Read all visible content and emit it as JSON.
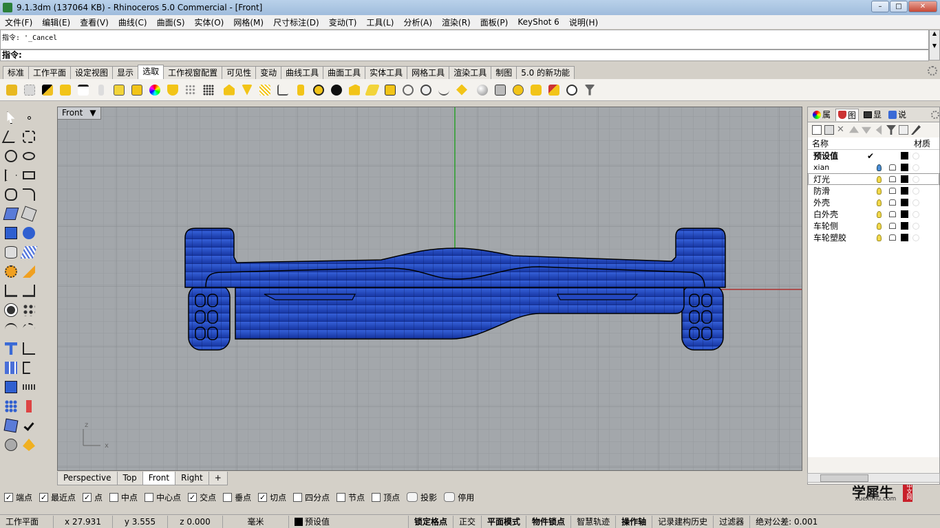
{
  "window": {
    "title": "9.1.3dm (137064 KB) - Rhinoceros 5.0 Commercial - [Front]",
    "minimize": "–",
    "maximize": "□",
    "close": "✕"
  },
  "menu": [
    "文件(F)",
    "编辑(E)",
    "查看(V)",
    "曲线(C)",
    "曲面(S)",
    "实体(O)",
    "网格(M)",
    "尺寸标注(D)",
    "变动(T)",
    "工具(L)",
    "分析(A)",
    "渲染(R)",
    "面板(P)",
    "KeyShot 6",
    "说明(H)"
  ],
  "command": {
    "history": "指令: '_Cancel",
    "prompt": "指令:"
  },
  "toolbar_tabs": [
    "标准",
    "工作平面",
    "设定视图",
    "显示",
    "选取",
    "工作视窗配置",
    "可见性",
    "变动",
    "曲线工具",
    "曲面工具",
    "实体工具",
    "网格工具",
    "渲染工具",
    "制图",
    "5.0 的新功能"
  ],
  "active_toolbar_tab": "选取",
  "toolbar_icons": [
    "select-points-icon",
    "select-curves-icon",
    "select-surfaces-icon",
    "select-polysurfaces-icon",
    "select-lines-icon",
    "select-blocks-icon",
    "select-text-icon",
    "select-solids-icon",
    "select-color-icon",
    "select-layer-icon",
    "select-pointcloud-icon",
    "select-dots-icon",
    "select-open-icon",
    "select-closed-icon",
    "select-hatch-icon",
    "select-annotation-icon",
    "select-group-icon",
    "select-lights-icon",
    "select-black-icon",
    "select-polyline-icon",
    "select-planar-icon",
    "select-boxes-icon",
    "select-spiral-icon",
    "select-mesh-icon",
    "select-curve-icon",
    "select-last-icon",
    "select-sphere-icon",
    "select-cube-icon",
    "select-render-icon",
    "select-material-icon",
    "select-brush-icon",
    "select-zoom-icon",
    "select-filter-icon"
  ],
  "viewport": {
    "name": "Front",
    "axis_z": "z",
    "axis_x": "x"
  },
  "viewport_tabs": [
    "Perspective",
    "Top",
    "Front",
    "Right",
    "+"
  ],
  "active_viewport_tab": "Front",
  "osnaps": [
    {
      "label": "端点",
      "checked": true
    },
    {
      "label": "最近点",
      "checked": true
    },
    {
      "label": "点",
      "checked": true
    },
    {
      "label": "中点",
      "checked": false
    },
    {
      "label": "中心点",
      "checked": false
    },
    {
      "label": "交点",
      "checked": true
    },
    {
      "label": "垂点",
      "checked": false
    },
    {
      "label": "切点",
      "checked": true
    },
    {
      "label": "四分点",
      "checked": false
    },
    {
      "label": "节点",
      "checked": false
    },
    {
      "label": "顶点",
      "checked": false
    }
  ],
  "osnap_toggles": [
    "投影",
    "停用"
  ],
  "status": {
    "cplane": "工作平面",
    "x": "x 27.931",
    "y": "y 3.555",
    "z": "z 0.000",
    "units": "毫米",
    "layer": "预设值",
    "grid_snap": "锁定格点",
    "ortho": "正交",
    "planar": "平面模式",
    "osnap": "物件锁点",
    "smarttrack": "智慧轨迹",
    "gumball": "操作轴",
    "history": "记录建构历史",
    "filter": "过滤器",
    "tolerance": "绝对公差: 0.001"
  },
  "panel": {
    "tabs": [
      "属",
      "图",
      "显",
      "说"
    ],
    "active_tab": "图",
    "header_name": "名称",
    "header_material": "材质",
    "check_mark": "✔",
    "layers": [
      {
        "name": "预设值",
        "current": true,
        "bulb": "none"
      },
      {
        "name": "xian",
        "current": false,
        "bulb": "blue"
      },
      {
        "name": "灯光",
        "current": false,
        "bulb": "yellow"
      },
      {
        "name": "防滑",
        "current": false,
        "bulb": "yellow"
      },
      {
        "name": "外壳",
        "current": false,
        "bulb": "yellow"
      },
      {
        "name": "白外壳",
        "current": false,
        "bulb": "yellow"
      },
      {
        "name": "车轮侧",
        "current": false,
        "bulb": "yellow"
      },
      {
        "name": "车轮塑胶",
        "current": false,
        "bulb": "yellow"
      }
    ]
  },
  "watermark": {
    "brand": "学犀牛",
    "site": "xuexiniu.com",
    "badge": "中文网"
  },
  "colors": {
    "model_blue": "#1a3fb0",
    "viewport_bg": "#a3a7ab",
    "grid": "#8e9296",
    "x_axis": "#b03030",
    "y_axis": "#2aa02a"
  }
}
